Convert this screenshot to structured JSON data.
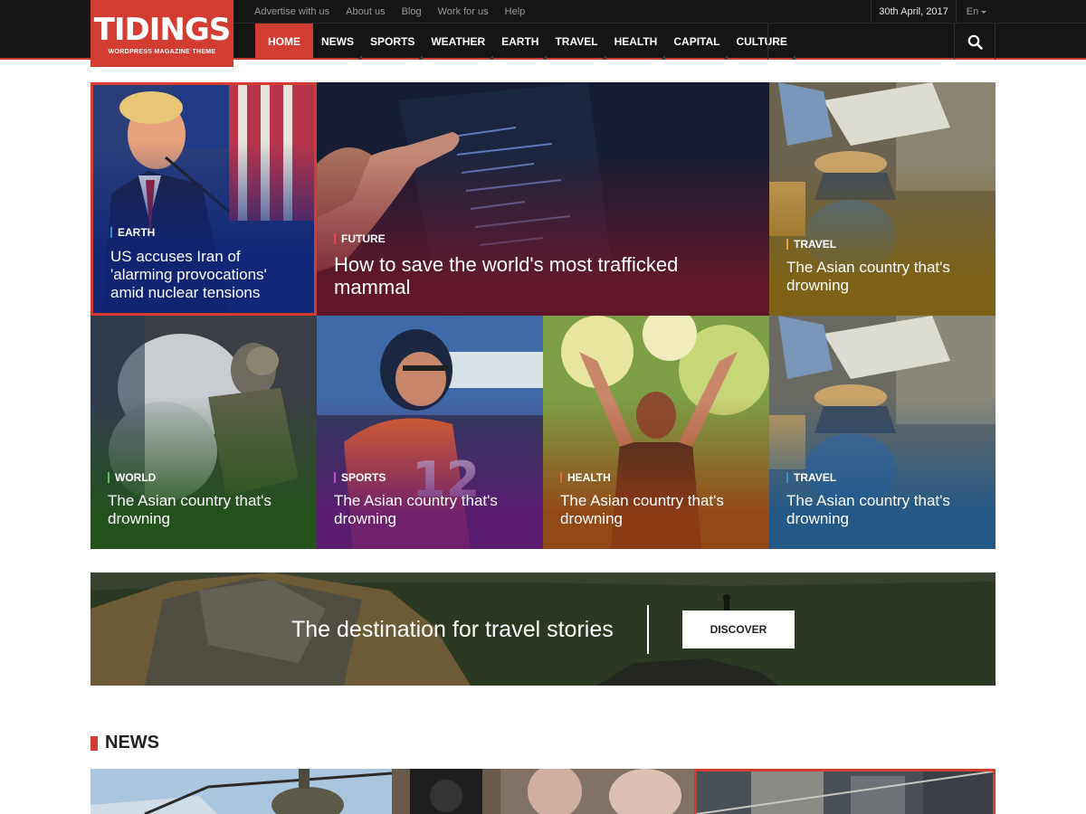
{
  "header": {
    "logo_title": "TIDINGS",
    "logo_subtitle": "WORDPRESS MAGAZINE THEME",
    "top_links": [
      "Advertise with us",
      "About us",
      "Blog",
      "Work for us",
      "Help"
    ],
    "date": "30th April, 2017",
    "language": "En",
    "nav": [
      "HOME",
      "NEWS",
      "SPORTS",
      "WEATHER",
      "EARTH",
      "TRAVEL",
      "HEALTH",
      "CAPITAL",
      "CULTURE"
    ],
    "active_nav": "HOME"
  },
  "featured": [
    {
      "category": "EARTH",
      "title": "US accuses Iran of 'alarming provocations' amid nuclear tensions",
      "cat_color": "#2f8fd8"
    },
    {
      "category": "FUTURE",
      "title": "How to save the world's most trafficked mammal",
      "cat_color": "#e8405a"
    },
    {
      "category": "TRAVEL",
      "title": "The Asian country that's drowning",
      "cat_color": "#e5a82a"
    },
    {
      "category": "WORLD",
      "title": "The Asian country that's drowning",
      "cat_color": "#5cc04a"
    },
    {
      "category": "SPORTS",
      "title": "The Asian country that's drowning",
      "cat_color": "#c84ad0"
    },
    {
      "category": "HEALTH",
      "title": "The Asian country that's drowning",
      "cat_color": "#f06a2a"
    },
    {
      "category": "TRAVEL",
      "title": "The Asian country that's drowning",
      "cat_color": "#2f8fd8"
    }
  ],
  "banner": {
    "text": "The destination for travel stories",
    "button": "DISCOVER"
  },
  "news_section": {
    "heading": "NEWS"
  },
  "colors": {
    "accent": "#d23c31",
    "header_bg": "#151515"
  }
}
